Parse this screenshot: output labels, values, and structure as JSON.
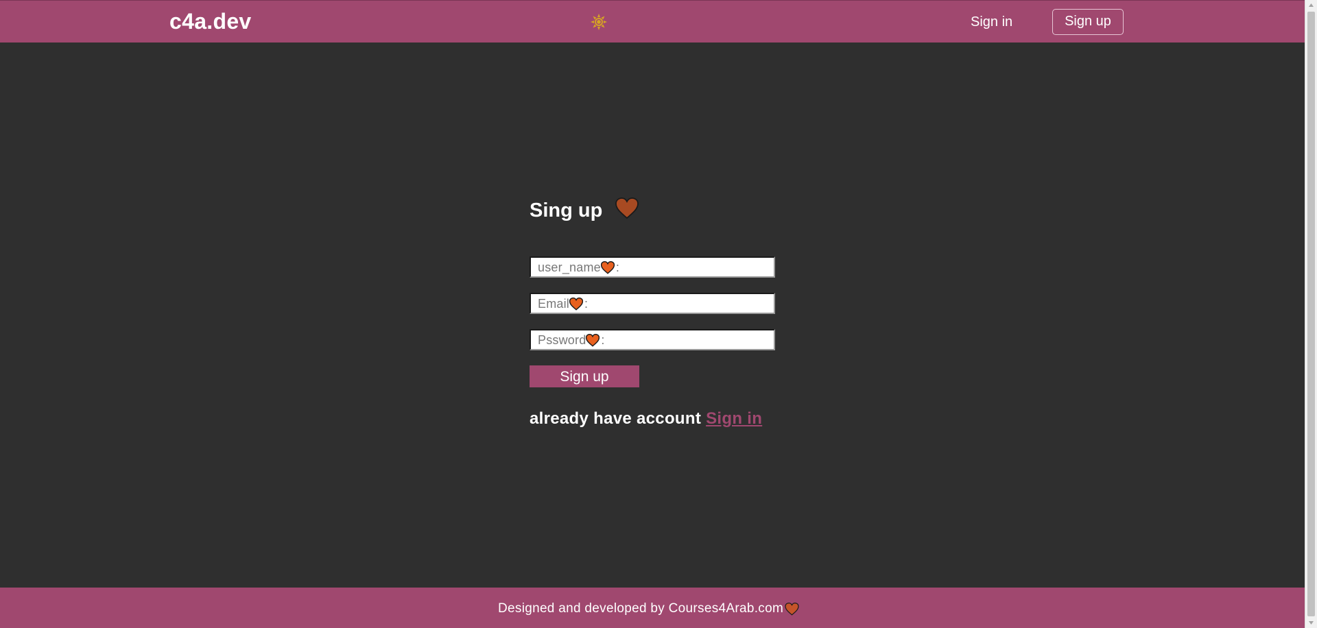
{
  "header": {
    "brand": "c4a.dev",
    "theme_toggle_icon": "sun-icon",
    "nav_signin": "Sign in",
    "nav_signup": "Sign up"
  },
  "form": {
    "title": "Sing up",
    "title_icon": "heart-icon",
    "fields": {
      "username": {
        "label": "user_name",
        "suffix": ":"
      },
      "email": {
        "label": "Email",
        "suffix": ":"
      },
      "password": {
        "label": "Pssword",
        "suffix": ":"
      }
    },
    "submit_label": "Sign up",
    "already_text": "already have account",
    "signin_link": "Sign in"
  },
  "footer": {
    "text": "Designed and developed by Courses4Arab.com"
  },
  "colors": {
    "accent": "#a0486f",
    "background": "#2f2f2f",
    "heart": "#e8601e",
    "heart_title": "#a84a22",
    "sun": "#d6a524"
  }
}
